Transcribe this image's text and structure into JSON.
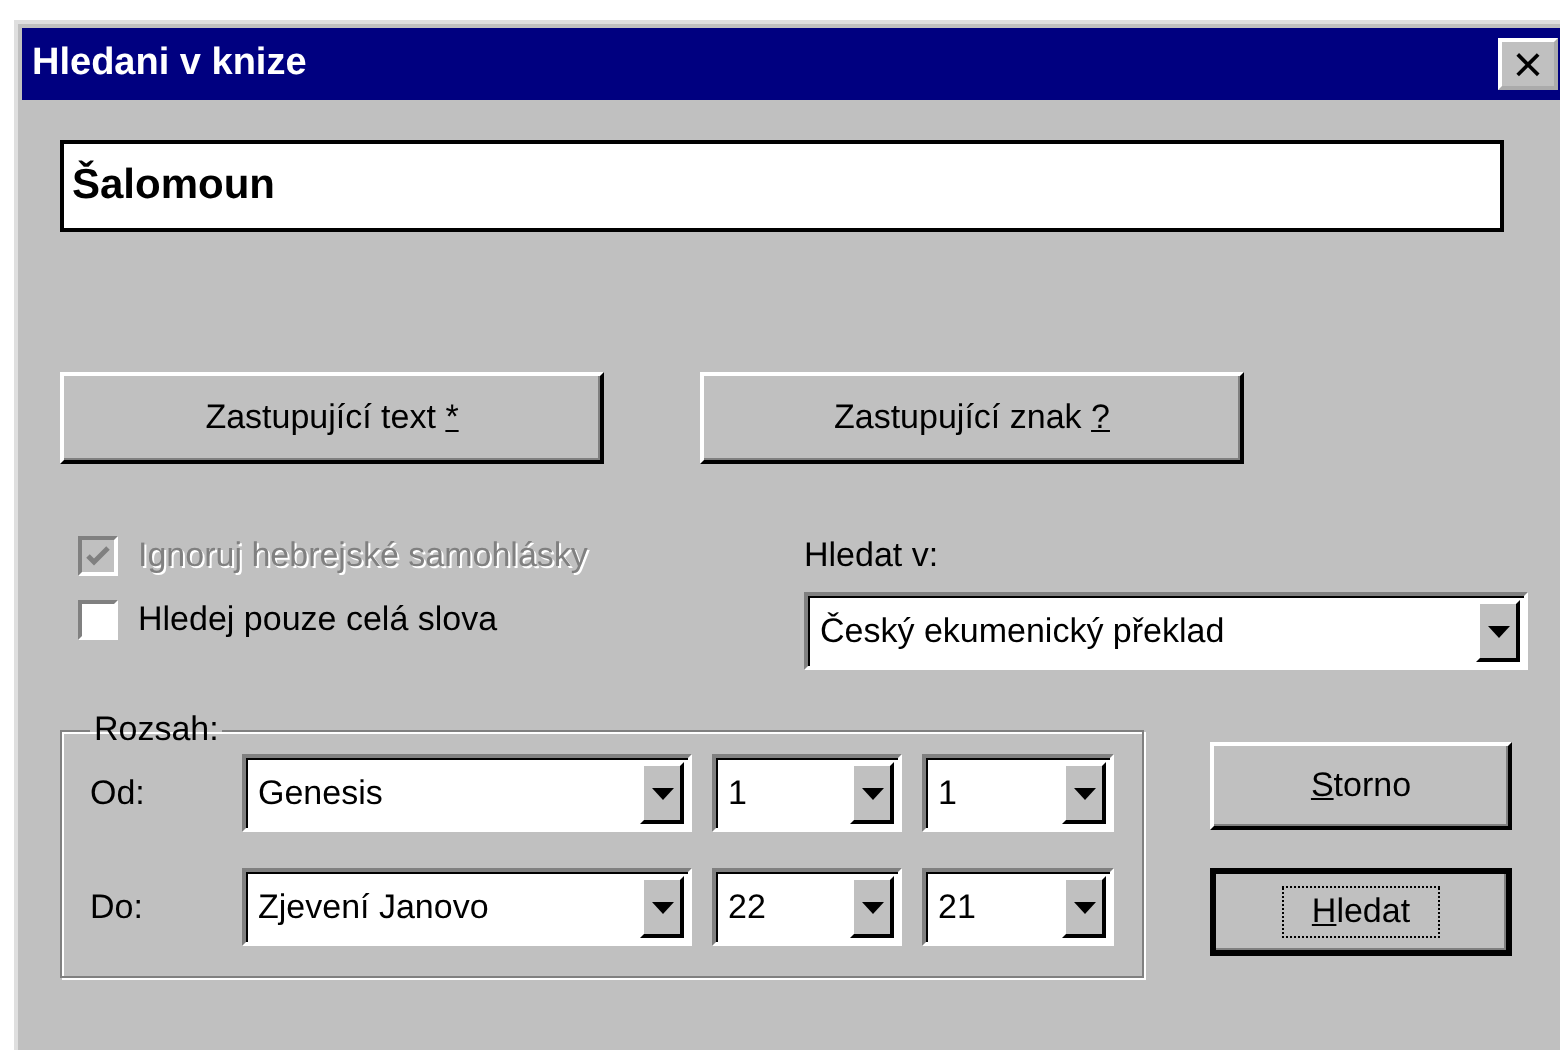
{
  "window": {
    "title": "Hledani v knize",
    "close_glyph": "×"
  },
  "search_field": {
    "value": "Šalomoun"
  },
  "wildcard_buttons": [
    {
      "prefix": "Zastupující text ",
      "key": "*"
    },
    {
      "prefix": "Zastupující znak ",
      "key": "?"
    }
  ],
  "options": [
    {
      "label": "Ignoruj hebrejské samohlásky",
      "checked": true,
      "disabled": true
    },
    {
      "label": "Hledej pouze celá slova",
      "checked": false,
      "disabled": false
    }
  ],
  "search_in": {
    "label": "Hledat v:",
    "value": "Český ekumenický překlad"
  },
  "range": {
    "title": "Rozsah:",
    "rows": [
      {
        "label": "Od:",
        "book": "Genesis",
        "chapter": "1",
        "verse": "1"
      },
      {
        "label": "Do:",
        "book": "Zjevení Janovo",
        "chapter": "22",
        "verse": "21"
      }
    ]
  },
  "buttons": [
    {
      "key": "S",
      "suffix": "torno",
      "focused": false
    },
    {
      "key": "H",
      "suffix": "ledat",
      "focused": true
    }
  ]
}
